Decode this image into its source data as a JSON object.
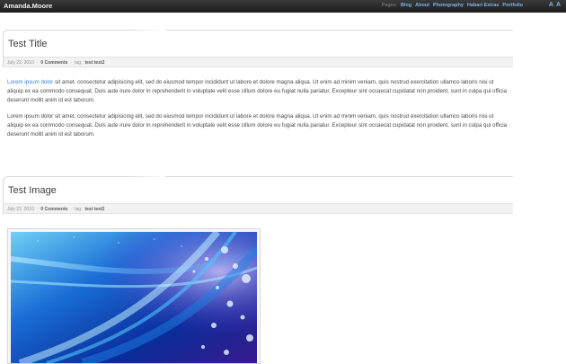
{
  "header": {
    "brand": "Amanda.Moore",
    "pages_label": "Pages:",
    "nav": [
      "Blog",
      "About",
      "Photography",
      "Habari Extras",
      "Portfolio"
    ],
    "font_controls": [
      "A",
      "A"
    ]
  },
  "posts": [
    {
      "title": "Test Title",
      "meta": {
        "date": "July 22, 2010",
        "comments": "0 Comments",
        "tag_label": "tag:",
        "tags": "test test2"
      },
      "paragraphs": [
        {
          "link": "Lorem ipsum dolor",
          "text": "sit amet, consectetur adipisicing elit, sed do eiusmod tempor incididunt ut labore et dolore magna aliqua. Ut enim ad minim veniam, quis nostrud exercitation ullamco laboris nisi ut aliquip ex ea commodo consequat. Duis aute irure dolor in reprehenderit in voluptate velit esse cillum dolore eu fugiat nulla pariatur. Excepteur sint occaecat cupidatat non proident, sunt in culpa qui officia deserunt mollit anim id est laborum."
        },
        {
          "text": "Lorem ipsum dolor sit amet, consectetur adipisicing elit, sed do eiusmod tempor incididunt ut labore et dolore magna aliqua. Ut enim ad minim veniam, quis nostrud exercitation ullamco laboris nisi ut aliquip ex ea commodo consequat. Duis aute irure dolor in reprehenderit in voluptate velit esse cillum dolore eu fugiat nulla pariatur. Excepteur sint occaecat cupidatat non proident, sunt in culpa qui officia deserunt mollit anim id est laborum."
        }
      ]
    },
    {
      "title": "Test Image",
      "meta": {
        "date": "July 22, 2010",
        "comments": "0 Comments",
        "tag_label": "tag:",
        "tags": "test test2"
      }
    }
  ],
  "colors": {
    "topbar": "#252525",
    "nav_link": "#7fb6ea",
    "body_link": "#3b82d1",
    "meta_bg": "#f2f2f2"
  }
}
